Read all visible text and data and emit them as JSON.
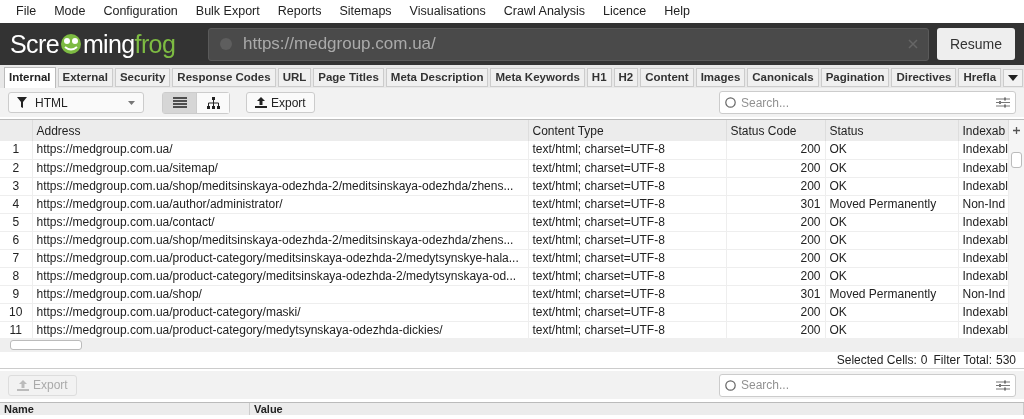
{
  "menu": [
    "File",
    "Mode",
    "Configuration",
    "Bulk Export",
    "Reports",
    "Sitemaps",
    "Visualisations",
    "Crawl Analysis",
    "Licence",
    "Help"
  ],
  "header": {
    "logo_start": "Scre",
    "logo_mid": "ming",
    "logo_end": "frog",
    "url": "https://medgroup.com.ua/",
    "action": "Resume"
  },
  "tabs": [
    {
      "label": "Internal",
      "selected": true
    },
    {
      "label": "External",
      "selected": false
    },
    {
      "label": "Security",
      "selected": false
    },
    {
      "label": "Response Codes",
      "selected": false
    },
    {
      "label": "URL",
      "selected": false
    },
    {
      "label": "Page Titles",
      "selected": false
    },
    {
      "label": "Meta Description",
      "selected": false
    },
    {
      "label": "Meta Keywords",
      "selected": false
    },
    {
      "label": "H1",
      "selected": false
    },
    {
      "label": "H2",
      "selected": false
    },
    {
      "label": "Content",
      "selected": false
    },
    {
      "label": "Images",
      "selected": false
    },
    {
      "label": "Canonicals",
      "selected": false
    },
    {
      "label": "Pagination",
      "selected": false
    },
    {
      "label": "Directives",
      "selected": false
    },
    {
      "label": "Hrefla",
      "selected": false
    }
  ],
  "toolbar": {
    "filter": "HTML",
    "views": [
      {
        "kind": "list",
        "selected": true
      },
      {
        "kind": "tree",
        "selected": false
      }
    ],
    "export": "Export",
    "search_placeholder": "Search..."
  },
  "table": {
    "columns": [
      "Address",
      "Content Type",
      "Status Code",
      "Status",
      "Indexab"
    ],
    "rows": [
      {
        "number": "1",
        "cells": [
          "https://medgroup.com.ua/",
          "text/html; charset=UTF-8",
          "200",
          "OK",
          "Indexabl"
        ]
      },
      {
        "number": "2",
        "cells": [
          "https://medgroup.com.ua/sitemap/",
          "text/html; charset=UTF-8",
          "200",
          "OK",
          "Indexabl"
        ]
      },
      {
        "number": "3",
        "cells": [
          "https://medgroup.com.ua/shop/meditsinskaya-odezhda-2/meditsinskaya-odezhda/zhens...",
          "text/html; charset=UTF-8",
          "200",
          "OK",
          "Indexabl"
        ]
      },
      {
        "number": "4",
        "cells": [
          "https://medgroup.com.ua/author/administrator/",
          "text/html; charset=UTF-8",
          "301",
          "Moved Permanently",
          "Non-Ind"
        ]
      },
      {
        "number": "5",
        "cells": [
          "https://medgroup.com.ua/contact/",
          "text/html; charset=UTF-8",
          "200",
          "OK",
          "Indexabl"
        ]
      },
      {
        "number": "6",
        "cells": [
          "https://medgroup.com.ua/shop/meditsinskaya-odezhda-2/meditsinskaya-odezhda/zhens...",
          "text/html; charset=UTF-8",
          "200",
          "OK",
          "Indexabl"
        ]
      },
      {
        "number": "7",
        "cells": [
          "https://medgroup.com.ua/product-category/meditsinskaya-odezhda-2/medytsynskye-hala...",
          "text/html; charset=UTF-8",
          "200",
          "OK",
          "Indexabl"
        ]
      },
      {
        "number": "8",
        "cells": [
          "https://medgroup.com.ua/product-category/meditsinskaya-odezhda-2/medytsynskaya-od...",
          "text/html; charset=UTF-8",
          "200",
          "OK",
          "Indexabl"
        ]
      },
      {
        "number": "9",
        "cells": [
          "https://medgroup.com.ua/shop/",
          "text/html; charset=UTF-8",
          "301",
          "Moved Permanently",
          "Non-Ind"
        ]
      },
      {
        "number": "10",
        "cells": [
          "https://medgroup.com.ua/product-category/maski/",
          "text/html; charset=UTF-8",
          "200",
          "OK",
          "Indexabl"
        ]
      },
      {
        "number": "11",
        "cells": [
          "https://medgroup.com.ua/product-category/medytsynskaya-odezhda-dickies/",
          "text/html; charset=UTF-8",
          "200",
          "OK",
          "Indexabl"
        ]
      }
    ]
  },
  "status_bar": {
    "selected_label": "Selected Cells:",
    "selected_value": "0",
    "total_label": "Filter Total:",
    "total_value": "530"
  },
  "lower_panel": {
    "export": "Export",
    "export_disabled": true,
    "search_placeholder": "Search...",
    "columns": [
      "Name",
      "Value"
    ]
  }
}
